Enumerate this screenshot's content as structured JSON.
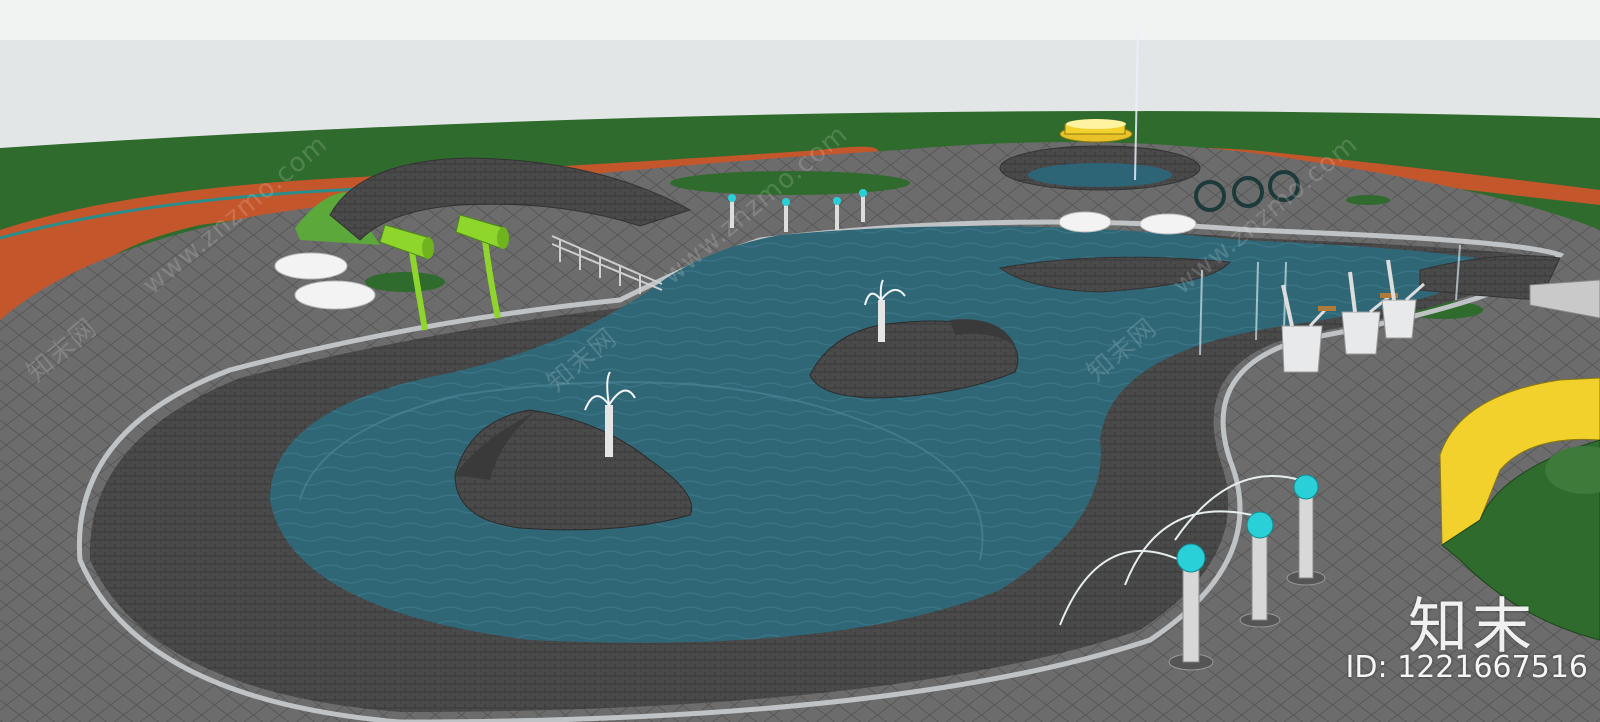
{
  "scene": {
    "subject": "water-play-park-render",
    "colors": {
      "sky": "#e9ecec",
      "grass": "#2f6b2c",
      "running_track": "#c4562c",
      "paving": "#6b6b6b",
      "cobble_rim": "#474747",
      "water": "#2e6576",
      "yellow_wall": "#f2d12c",
      "slide_green": "#8fd62c",
      "jet_cap": "#2ad0d8"
    }
  },
  "watermark": {
    "diagonal_text": "www.znzmo.com",
    "cn_text": "知末网",
    "logo_text": "知末",
    "id_text": "ID: 1221667516"
  }
}
